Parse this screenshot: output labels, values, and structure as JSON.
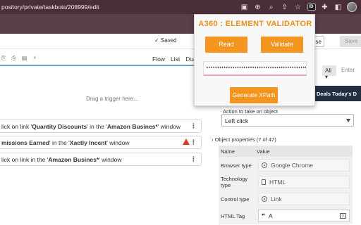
{
  "browser": {
    "url": "pository/private/taskbots/208999/edit"
  },
  "toolbar": {
    "saved_label": "✓ Saved",
    "close_label": "ose",
    "save_label": "Save"
  },
  "view_tabs": [
    "Flow",
    "List",
    "Dua"
  ],
  "canvas": {
    "trigger_text": "Drag a trigger here..."
  },
  "actions": [
    {
      "prefix": "lick on link '",
      "bold": "Quantity Discounts",
      "middle": "' in the '",
      "bold2": "Amazon Busines*",
      "suffix": "' window",
      "warning": false
    },
    {
      "prefix": "missions Earned",
      "bold": "",
      "middle": "' in the '",
      "bold2": "Xactly Incent",
      "suffix": "' window",
      "warning": true
    },
    {
      "prefix": "lick on link in the '",
      "bold": "",
      "middle": "",
      "bold2": "Amazon Busines*",
      "suffix": "' window",
      "warning": false
    }
  ],
  "right_panel": {
    "action_label": "Action to take on object",
    "action_value": "Left click",
    "object_properties": "Object properties (7 of 47)",
    "table_headers": [
      "Name",
      "Value"
    ],
    "rows": [
      {
        "name": "Browser type",
        "value": "Google Chrome",
        "icon": "chrome-icon"
      },
      {
        "name": "Technology type",
        "value": "HTML",
        "icon": "html-icon"
      },
      {
        "name": "Control type",
        "value": "Link",
        "icon": "link-icon"
      },
      {
        "name": "HTML Tag",
        "value": "A",
        "icon": "quote-icon"
      }
    ]
  },
  "webpage": {
    "category": "All",
    "search_placeholder": "Enter",
    "nav_text": "Deals  Today's D"
  },
  "popup": {
    "title": "A360 : ELEMENT VALIDATOR",
    "read_label": "Read",
    "validate_label": "Validate",
    "xpath_value": "••••••••••••••••••••••••••••••••••••••••••••••••••",
    "generate_label": "Generate XPath",
    "accent_color": "#f3951e"
  }
}
